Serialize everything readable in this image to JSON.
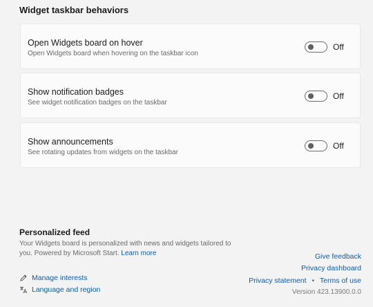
{
  "section": {
    "title": "Widget taskbar behaviors"
  },
  "settings": [
    {
      "title": "Open Widgets board on hover",
      "description": "Open Widgets board when hovering on the taskbar icon",
      "state": "Off"
    },
    {
      "title": "Show notification badges",
      "description": "See widget notification badges on the taskbar",
      "state": "Off"
    },
    {
      "title": "Show announcements",
      "description": "See rotating updates from widgets on the taskbar",
      "state": "Off"
    }
  ],
  "feed": {
    "title": "Personalized feed",
    "description": "Your Widgets board is personalized with news and widgets tailored to you. Powered by Microsoft Start.",
    "learn_more": "Learn more"
  },
  "links": {
    "manage_interests": "Manage interests",
    "language_region": "Language and region",
    "give_feedback": "Give feedback",
    "privacy_dashboard": "Privacy dashboard",
    "privacy_statement": "Privacy statement",
    "separator": "•",
    "terms_of_use": "Terms of use"
  },
  "version": "Version 423.13900.0.0",
  "icons": {
    "manage_interests": "pencil-icon",
    "language_region": "language-icon"
  },
  "colors": {
    "link": "#0b5cad",
    "background": "#f3f3f3",
    "card": "#fbfbfb"
  }
}
